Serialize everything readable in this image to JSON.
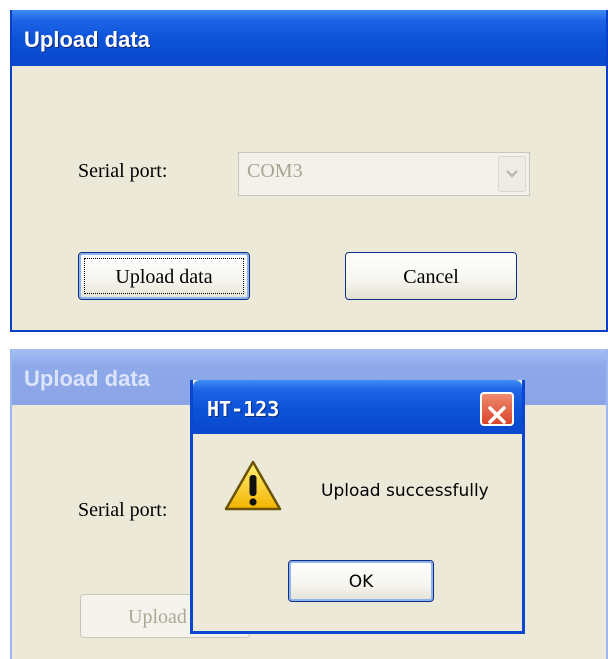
{
  "dialog1": {
    "title": "Upload data",
    "serial_port_label": "Serial port:",
    "serial_port_value": "COM3",
    "upload_button": "Upload data",
    "cancel_button": "Cancel"
  },
  "dialog2": {
    "title": "Upload data",
    "serial_port_label": "Serial port:",
    "upload_button_partial": "Upload d"
  },
  "message_box": {
    "title": "HT-123",
    "icon": "warning-icon",
    "message": "Upload successfully",
    "ok_button": "OK"
  }
}
